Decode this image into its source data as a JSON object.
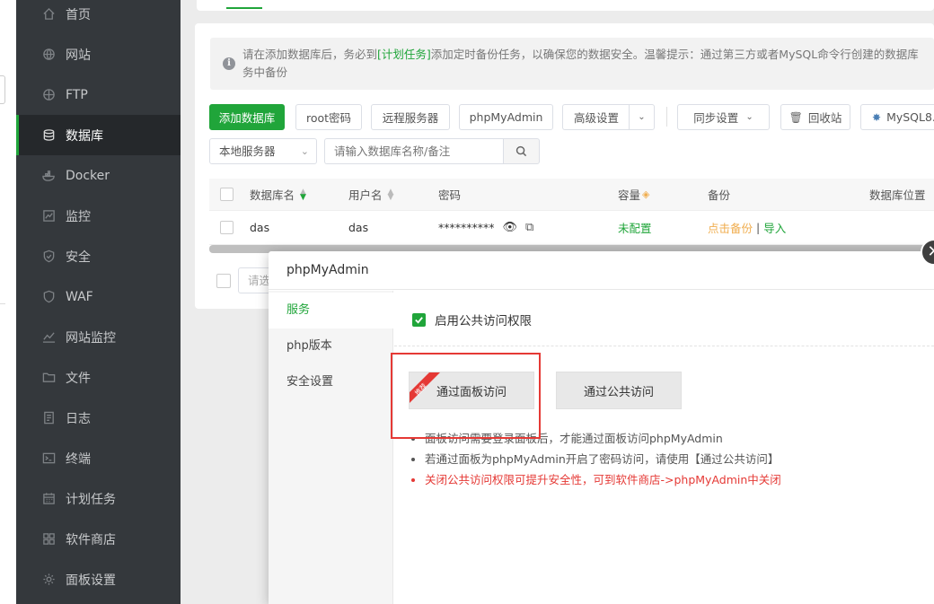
{
  "sidebar": {
    "items": [
      {
        "label": "首页",
        "icon": "home-icon"
      },
      {
        "label": "网站",
        "icon": "globe-icon"
      },
      {
        "label": "FTP",
        "icon": "ftp-globe-icon"
      },
      {
        "label": "数据库",
        "icon": "database-icon",
        "active": true
      },
      {
        "label": "Docker",
        "icon": "docker-icon"
      },
      {
        "label": "监控",
        "icon": "monitor-icon"
      },
      {
        "label": "安全",
        "icon": "shield-icon"
      },
      {
        "label": "WAF",
        "icon": "waf-shield-icon"
      },
      {
        "label": "网站监控",
        "icon": "chart-line-icon"
      },
      {
        "label": "文件",
        "icon": "folder-icon"
      },
      {
        "label": "日志",
        "icon": "log-icon"
      },
      {
        "label": "终端",
        "icon": "terminal-icon"
      },
      {
        "label": "计划任务",
        "icon": "calendar-icon"
      },
      {
        "label": "软件商店",
        "icon": "apps-icon"
      },
      {
        "label": "面板设置",
        "icon": "gear-icon"
      }
    ]
  },
  "notice": {
    "pre": "请在添加数据库后，务必到",
    "link": "[计划任务]",
    "post": "添加定时备份任务，以确保您的数据安全。温馨提示：通过第三方或者MySQL命令行创建的数据库",
    "line2": "务中备份"
  },
  "toolbar": {
    "add_db": "添加数据库",
    "root_pwd": "root密码",
    "remote_server": "远程服务器",
    "phpmyadmin": "phpMyAdmin",
    "advanced": "高级设置",
    "sync": "同步设置",
    "recycle": "回收站",
    "mysql": "MySQL8."
  },
  "filter": {
    "server": "本地服务器",
    "search_placeholder": "请输入数据库名称/备注"
  },
  "table": {
    "headers": {
      "name": "数据库名",
      "user": "用户名",
      "password": "密码",
      "capacity": "容量",
      "backup": "备份",
      "location": "数据库位置"
    },
    "rows": [
      {
        "name": "das",
        "user": "das",
        "password": "**********",
        "capacity": "未配置",
        "backup_link": "点击备份",
        "backup_sep": "|",
        "import_link": "导入"
      }
    ]
  },
  "pager": {
    "select_text": "请选"
  },
  "modal": {
    "title": "phpMyAdmin",
    "nav": [
      {
        "label": "服务",
        "active": true
      },
      {
        "label": "php版本"
      },
      {
        "label": "安全设置"
      }
    ],
    "public_access_label": "启用公共访问权限",
    "public_access_checked": true,
    "btn_panel": "通过面板访问",
    "btn_panel_ribbon": "推荐",
    "btn_public": "通过公共访问",
    "tips": [
      "面板访问需要登录面板后，才能通过面板访问phpMyAdmin",
      "若通过面板为phpMyAdmin开启了密码访问，请使用【通过公共访问】",
      "关闭公共访问权限可提升安全性，可到软件商店->phpMyAdmin中关闭"
    ]
  },
  "colors": {
    "accent": "#20a53a",
    "sidebar_bg": "#34383c",
    "warning": "#f0ad4e",
    "danger": "#e53935"
  }
}
